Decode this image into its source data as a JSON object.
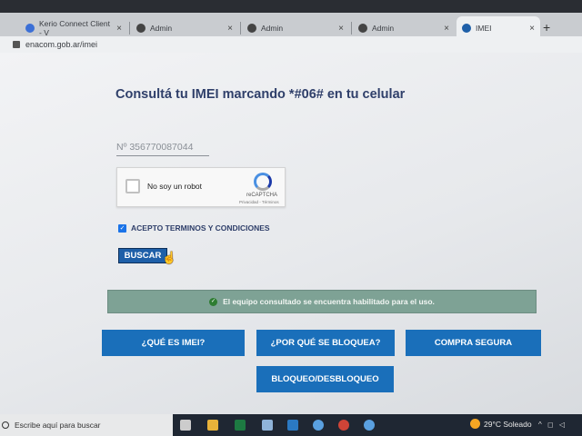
{
  "browser": {
    "tabs": [
      {
        "label": "Kerio Connect Client - V",
        "close": "×",
        "fav_color": "#3b6fd6"
      },
      {
        "label": "Admin",
        "close": "×",
        "fav_color": "#444"
      },
      {
        "label": "Admin",
        "close": "×",
        "fav_color": "#444"
      },
      {
        "label": "Admin",
        "close": "×",
        "fav_color": "#444"
      },
      {
        "label": "IMEI",
        "close": "×",
        "fav_color": "#1e5fa8"
      }
    ],
    "new_tab": "+",
    "url": "enacom.gob.ar/imei"
  },
  "page": {
    "title": "Consultá tu IMEI marcando *#06# en tu celular",
    "imei_field_value": "Nº 356770087044",
    "captcha": {
      "label": "No soy un robot",
      "brand": "reCAPTCHA",
      "links": "Privacidad - Términos"
    },
    "terms_label": "ACEPTO TERMINOS Y CONDICIONES",
    "terms_checked": "✓",
    "search_button": "BUSCAR",
    "status_message": "El equipo consultado se encuentra habilitado para el uso.",
    "status_icon": "✓",
    "nav_buttons": {
      "what_is_imei": "¿QUÉ ES IMEI?",
      "why_blocked": "¿POR QUÉ SE BLOQUEA?",
      "safe_purchase": "COMPRA SEGURA",
      "block_unblock": "BLOQUEO/DESBLOQUEO"
    }
  },
  "taskbar": {
    "search_placeholder": "Escribe aquí para buscar",
    "weather": "29°C  Soleado"
  },
  "colors": {
    "accent_blue": "#1a6fba",
    "title_navy": "#2f3f6a",
    "success_green": "#7ea295"
  }
}
